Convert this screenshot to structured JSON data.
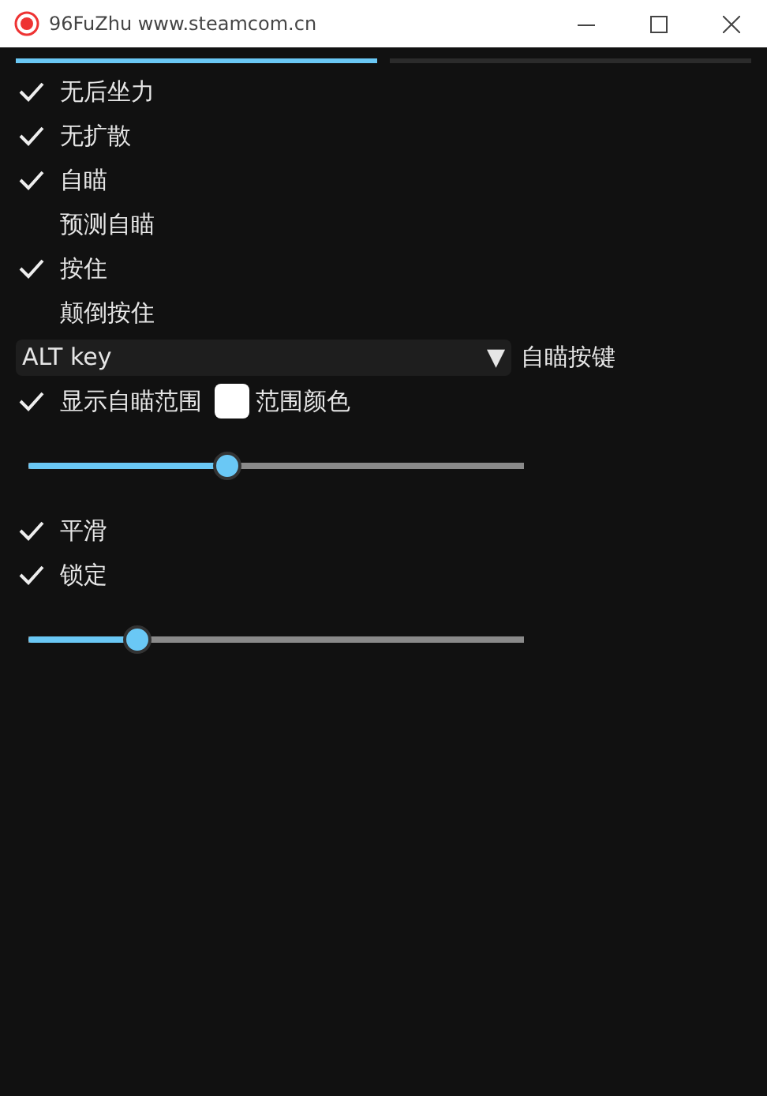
{
  "window": {
    "title": "96FuZhu www.steamcom.cn"
  },
  "tabs": [
    {
      "selected": true
    },
    {
      "selected": false
    }
  ],
  "items": [
    {
      "kind": "checkbox",
      "label": "无后坐力",
      "checked": true
    },
    {
      "kind": "checkbox",
      "label": "无扩散",
      "checked": true
    },
    {
      "kind": "checkbox",
      "label": "自瞄",
      "checked": true
    },
    {
      "kind": "checkbox",
      "label": "预测自瞄",
      "checked": false
    },
    {
      "kind": "checkbox",
      "label": "按住",
      "checked": true
    },
    {
      "kind": "checkbox",
      "label": "颠倒按住",
      "checked": false
    },
    {
      "kind": "dropdown",
      "selected_option": "ALT key",
      "arrow": "▼",
      "label": "自瞄按键"
    },
    {
      "kind": "checkbox-color",
      "label": "显示自瞄范围",
      "checked": true,
      "color": "#ffffff",
      "color_label": "范围颜色"
    },
    {
      "kind": "slider",
      "level": 0.4
    },
    {
      "kind": "checkbox",
      "label": "平滑",
      "checked": true
    },
    {
      "kind": "checkbox",
      "label": "锁定",
      "checked": true
    },
    {
      "kind": "slider",
      "level": 0.22
    }
  ]
}
